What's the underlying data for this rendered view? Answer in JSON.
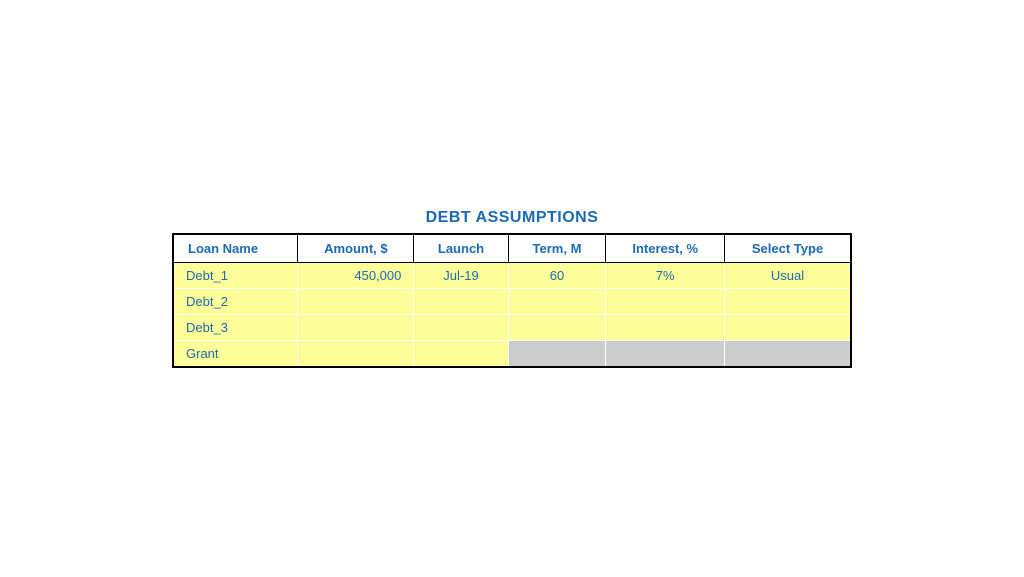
{
  "title": "DEBT ASSUMPTIONS",
  "table": {
    "headers": [
      {
        "label": "Loan Name",
        "align": "left"
      },
      {
        "label": "Amount, $",
        "align": "center"
      },
      {
        "label": "Launch",
        "align": "center"
      },
      {
        "label": "Term, M",
        "align": "center"
      },
      {
        "label": "Interest, %",
        "align": "center"
      },
      {
        "label": "Select Type",
        "align": "center"
      }
    ],
    "rows": [
      {
        "type": "yellow",
        "cells": [
          {
            "value": "Debt_1",
            "align": "left",
            "bg": "yellow"
          },
          {
            "value": "450,000",
            "align": "right",
            "bg": "yellow"
          },
          {
            "value": "Jul-19",
            "align": "center",
            "bg": "yellow"
          },
          {
            "value": "60",
            "align": "center",
            "bg": "yellow"
          },
          {
            "value": "7%",
            "align": "center",
            "bg": "yellow"
          },
          {
            "value": "Usual",
            "align": "center",
            "bg": "yellow"
          }
        ]
      },
      {
        "type": "yellow",
        "cells": [
          {
            "value": "Debt_2",
            "align": "left",
            "bg": "yellow"
          },
          {
            "value": "",
            "align": "right",
            "bg": "yellow"
          },
          {
            "value": "",
            "align": "center",
            "bg": "yellow"
          },
          {
            "value": "",
            "align": "center",
            "bg": "yellow"
          },
          {
            "value": "",
            "align": "center",
            "bg": "yellow"
          },
          {
            "value": "",
            "align": "center",
            "bg": "yellow"
          }
        ]
      },
      {
        "type": "yellow",
        "cells": [
          {
            "value": "Debt_3",
            "align": "left",
            "bg": "yellow"
          },
          {
            "value": "",
            "align": "right",
            "bg": "yellow"
          },
          {
            "value": "",
            "align": "center",
            "bg": "yellow"
          },
          {
            "value": "",
            "align": "center",
            "bg": "yellow"
          },
          {
            "value": "",
            "align": "center",
            "bg": "yellow"
          },
          {
            "value": "",
            "align": "center",
            "bg": "yellow"
          }
        ]
      },
      {
        "type": "grant",
        "cells": [
          {
            "value": "Grant",
            "align": "left",
            "bg": "yellow"
          },
          {
            "value": "",
            "align": "right",
            "bg": "yellow"
          },
          {
            "value": "",
            "align": "center",
            "bg": "yellow"
          },
          {
            "value": "",
            "align": "center",
            "bg": "gray"
          },
          {
            "value": "",
            "align": "center",
            "bg": "gray"
          },
          {
            "value": "",
            "align": "center",
            "bg": "gray"
          }
        ]
      }
    ]
  }
}
